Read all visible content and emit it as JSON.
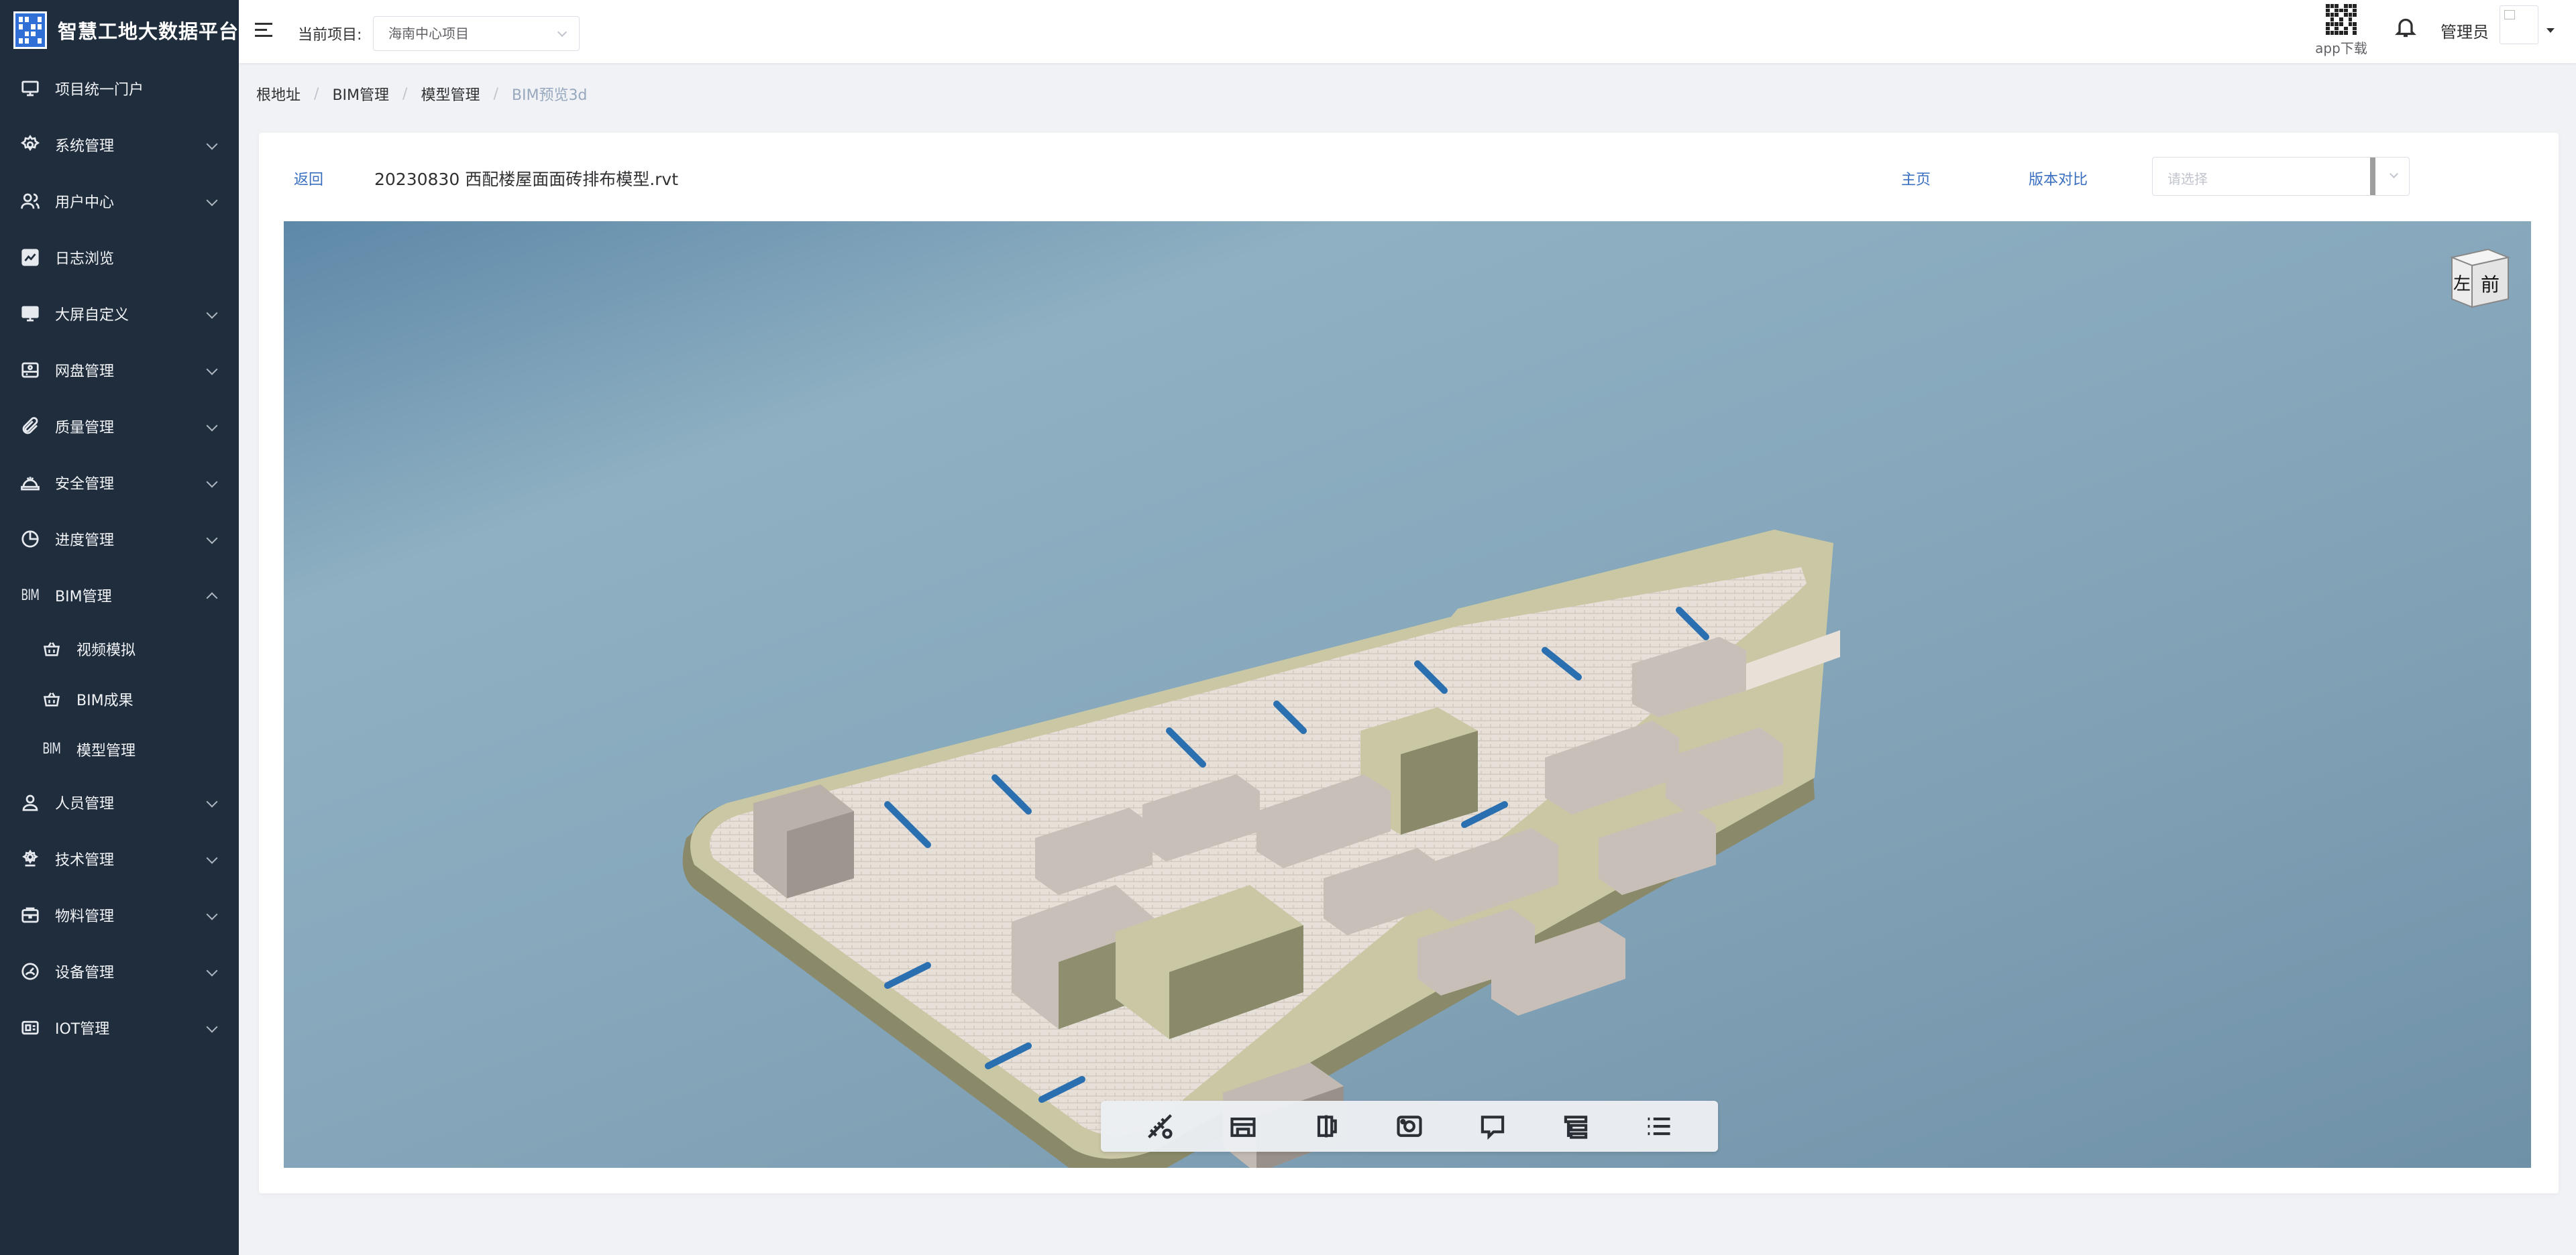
{
  "app": {
    "title": "智慧工地大数据平台"
  },
  "sidebar": {
    "items": [
      {
        "label": "项目统一门户",
        "icon": "monitor-icon"
      },
      {
        "label": "系统管理",
        "icon": "gear-icon"
      },
      {
        "label": "用户中心",
        "icon": "users-icon"
      },
      {
        "label": "日志浏览",
        "icon": "chart-icon"
      },
      {
        "label": "大屏自定义",
        "icon": "screen-icon"
      },
      {
        "label": "网盘管理",
        "icon": "disk-icon"
      },
      {
        "label": "质量管理",
        "icon": "paperclip-icon"
      },
      {
        "label": "安全管理",
        "icon": "helmet-icon"
      },
      {
        "label": "进度管理",
        "icon": "pie-icon"
      },
      {
        "label": "BIM管理",
        "icon": "bim-text-icon"
      },
      {
        "label": "人员管理",
        "icon": "person-icon"
      },
      {
        "label": "技术管理",
        "icon": "tech-icon"
      },
      {
        "label": "物料管理",
        "icon": "box-icon"
      },
      {
        "label": "设备管理",
        "icon": "gauge-icon"
      },
      {
        "label": "IOT管理",
        "icon": "iot-icon"
      }
    ],
    "bim_sub": [
      {
        "label": "视频模拟",
        "icon": "basket-icon"
      },
      {
        "label": "BIM成果",
        "icon": "basket-icon"
      },
      {
        "label": "模型管理",
        "icon": "bim-text-icon"
      }
    ],
    "bim_icon_text": "BIM"
  },
  "header": {
    "project_label": "当前项目:",
    "project_value": "海南中心项目",
    "app_download": "app下载",
    "user_name": "管理员"
  },
  "breadcrumb": [
    "根地址",
    "BIM管理",
    "模型管理",
    "BIM预览3d"
  ],
  "toolbar": {
    "back": "返回",
    "file_name": "20230830 西配楼屋面面砖排布模型.rvt",
    "home": "主页",
    "compare": "版本对比",
    "version_placeholder": "请选择"
  },
  "viewer": {
    "navcube_left": "左",
    "navcube_front": "前",
    "tools": [
      "measure-icon",
      "building-icon",
      "section-icon",
      "snapshot-icon",
      "frame-icon",
      "tree-icon",
      "list-icon"
    ]
  }
}
